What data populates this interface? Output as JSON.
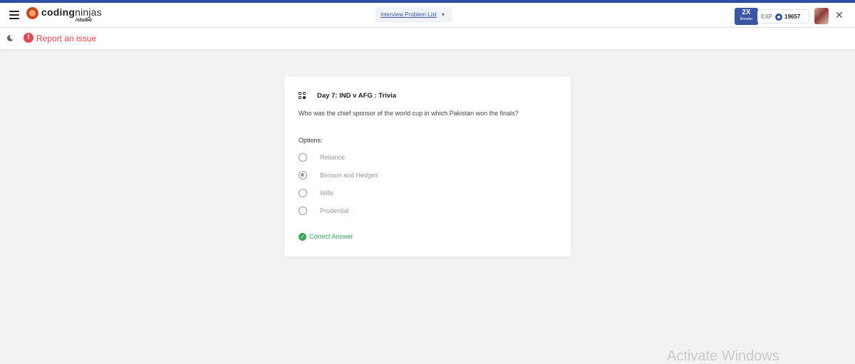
{
  "brand": {
    "name_bold": "coding",
    "name_light": "ninjas",
    "sub": "/studio"
  },
  "header": {
    "problem_list_label": "Interview Problem List",
    "booster_multiplier": "2X",
    "booster_label": "Booster",
    "exp_label": "EXP",
    "exp_value": "19657"
  },
  "subbar": {
    "report_label": "Report an issue",
    "report_icon_glyph": "!"
  },
  "card": {
    "title": "Day 7: IND v AFG : Trivia",
    "question": "Who was the chief sponsor of the world cup in which Pakistan won the finals?",
    "options_label": "Options:",
    "options": [
      {
        "label": "Reliance",
        "selected": false
      },
      {
        "label": "Benson and Hedges",
        "selected": true
      },
      {
        "label": "Wills",
        "selected": false
      },
      {
        "label": "Prudential",
        "selected": false
      }
    ],
    "result": "Correct Answer"
  },
  "watermark": "Activate Windows",
  "colors": {
    "accent": "#2c4fa5",
    "error": "#e5484d",
    "success": "#3ea25c"
  }
}
